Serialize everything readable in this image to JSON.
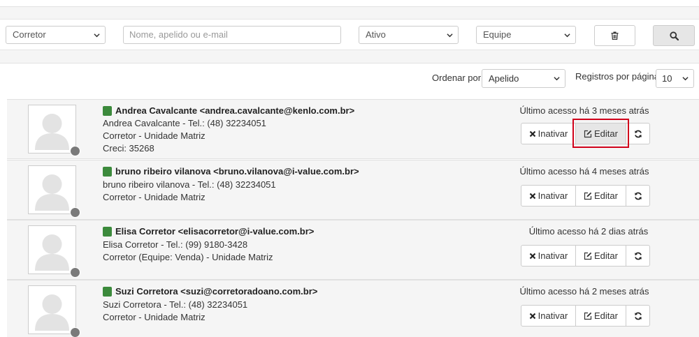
{
  "filters": {
    "role_select": "Corretor",
    "search_placeholder": "Nome, apelido ou e-mail",
    "status_select": "Ativo",
    "team_select": "Equipe"
  },
  "sort": {
    "label": "Ordenar por",
    "value": "Apelido",
    "per_page_label": "Registros por página",
    "per_page_value": "10"
  },
  "actions": {
    "inactivate": "Inativar",
    "edit": "Editar"
  },
  "users": [
    {
      "header": "Andrea Cavalcante <andrea.cavalcante@kenlo.com.br>",
      "line1": "Andrea Cavalcante - Tel.: (48) 32234051",
      "line2": "Corretor  - Unidade Matriz",
      "line3": "Creci: 35268",
      "last_access": "Último acesso há 3 meses atrás"
    },
    {
      "header": "bruno ribeiro vilanova <bruno.vilanova@i-value.com.br>",
      "line1": "bruno ribeiro vilanova - Tel.: (48) 32234051",
      "line2": "Corretor  - Unidade Matriz",
      "last_access": "Último acesso há 4 meses atrás"
    },
    {
      "header": "Elisa Corretor <elisacorretor@i-value.com.br>",
      "line1": "Elisa Corretor - Tel.: (99) 9180-3428",
      "line2": "Corretor  (Equipe: Venda) - Unidade Matriz",
      "last_access": "Último acesso há 2 dias atrás"
    },
    {
      "header": "Suzi Corretora <suzi@corretoradoano.com.br>",
      "line1": "Suzi Corretora - Tel.: (48) 32234051",
      "line2": "Corretor  - Unidade Matriz",
      "last_access": "Último acesso há 2 meses atrás"
    }
  ],
  "colors": {
    "status_active": "#3c8a3c",
    "highlight": "#d0021b"
  },
  "icons": [
    "chevron-down-icon",
    "trash-icon",
    "search-icon",
    "user-avatar-icon",
    "times-icon",
    "edit-icon",
    "refresh-icon"
  ]
}
